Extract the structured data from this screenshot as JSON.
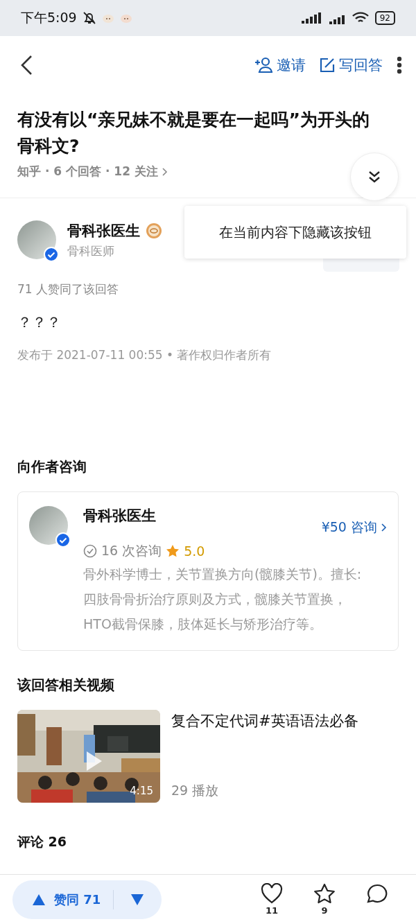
{
  "status_bar": {
    "time": "下午5:09",
    "battery": "92"
  },
  "nav": {
    "actions": [
      {
        "kind": "invite",
        "label": "邀请"
      },
      {
        "kind": "write",
        "label": "写回答"
      }
    ]
  },
  "question": {
    "title": "有没有以“亲兄妹不就是要在一起吗”为开头的骨科文?",
    "meta": "知乎 · 6 个回答 · 12 关注"
  },
  "popup": {
    "text": "在当前内容下隐藏该按钮"
  },
  "author": {
    "name": "骨科张医生",
    "title": "骨科医师",
    "verified": true
  },
  "answer": {
    "votes_line": "71 人赞同了该回答",
    "body": "？？？",
    "published": "发布于 2021-07-11 00:55 • 著作权归作者所有"
  },
  "consult": {
    "heading": "向作者咨询",
    "name": "骨科张医生",
    "verified": true,
    "count": "16 次咨询",
    "rating": "5.0",
    "price": "¥50 咨询",
    "bio": "骨外科学博士，关节置换方向(髋膝关节)。擅长:四肢骨骨折治疗原则及方式，髋膝关节置换，HTO截骨保膝，肢体延长与矫形治疗等。"
  },
  "video": {
    "heading": "该回答相关视频",
    "title": "复合不定代词#英语语法必备",
    "plays": "29 播放",
    "duration": "4:15"
  },
  "comments": {
    "label": "评论 26"
  },
  "bottom_bar": {
    "upvote": "赞同 71",
    "actions": [
      {
        "kind": "like",
        "count": "11"
      },
      {
        "kind": "star",
        "count": "9"
      },
      {
        "kind": "comment"
      }
    ]
  }
}
